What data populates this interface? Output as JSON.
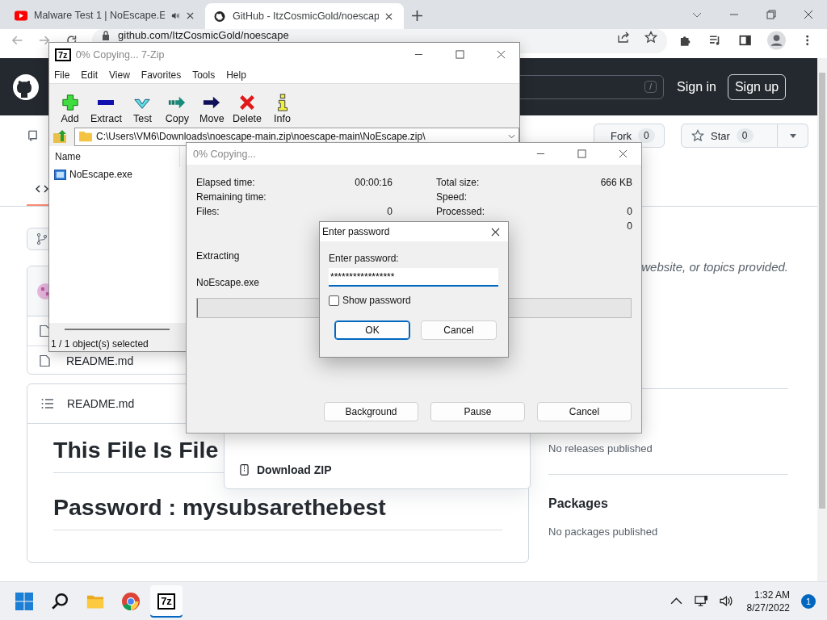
{
  "browser": {
    "tabs": [
      {
        "kind": "youtube",
        "title": "Malware Test 1 | NoEscape.E",
        "audio": true,
        "selected": false
      },
      {
        "kind": "github",
        "title": "GitHub - ItzCosmicGold/noescap",
        "audio": false,
        "selected": true
      }
    ],
    "url": "github.com/ItzCosmicGold/noescape"
  },
  "github": {
    "search_key": "/",
    "sign_in": "Sign in",
    "sign_up": "Sign up",
    "fork": {
      "label": "Fork",
      "count": "0"
    },
    "star": {
      "label": "Star",
      "count": "0"
    },
    "files": [
      "README.md"
    ],
    "readme": {
      "title": "README.md",
      "headings": [
        "This File Is File",
        "Password : mysubsarethebest"
      ]
    },
    "about": "website, or topics provided.",
    "releases_empty": "No releases published",
    "packages_title": "Packages",
    "packages_empty": "No packages published",
    "download_menu": [
      "Download ZIP"
    ]
  },
  "sevenzip": {
    "icon_text": "7z",
    "title": "0% Copying... 7-Zip",
    "menu": [
      "File",
      "Edit",
      "View",
      "Favorites",
      "Tools",
      "Help"
    ],
    "toolbar": [
      {
        "kind": "add",
        "label": "Add"
      },
      {
        "kind": "extract",
        "label": "Extract"
      },
      {
        "kind": "test",
        "label": "Test"
      },
      {
        "kind": "copy",
        "label": "Copy"
      },
      {
        "kind": "move",
        "label": "Move"
      },
      {
        "kind": "delete",
        "label": "Delete"
      },
      {
        "kind": "info",
        "label": "Info"
      }
    ],
    "path": "C:\\Users\\VM6\\Downloads\\noescape-main.zip\\noescape-main\\NoEscape.zip\\",
    "column": "Name",
    "items": [
      {
        "name": "NoEscape.exe",
        "selected": false
      }
    ],
    "status": "1 / 1 object(s) selected"
  },
  "progress": {
    "title": "0% Copying...",
    "left": [
      {
        "label": "Elapsed time:",
        "value": "00:00:16"
      },
      {
        "label": "Remaining time:"
      },
      {
        "label": "Files:",
        "value": "0"
      }
    ],
    "right": [
      {
        "label": "Total size:",
        "value": "666 KB"
      },
      {
        "label": "Speed:"
      },
      {
        "label": "Processed:",
        "value": "0"
      },
      {
        "value": "0"
      }
    ],
    "action": "Extracting",
    "file": "NoEscape.exe",
    "level": 0,
    "buttons": [
      "Background",
      "Pause",
      "Cancel"
    ]
  },
  "password": {
    "title": "Enter password",
    "label": "Enter password:",
    "value": "*****************",
    "show_label": "Show password",
    "checked": false,
    "buttons": [
      {
        "label": "OK",
        "default": true
      },
      {
        "label": "Cancel",
        "default": false
      }
    ]
  },
  "taskbar": {
    "apps": [
      {
        "kind": "start",
        "active": false
      },
      {
        "kind": "search",
        "active": false
      },
      {
        "kind": "folder",
        "active": false
      },
      {
        "kind": "chrome",
        "active": false
      },
      {
        "kind": "sevenzip",
        "label": "7z",
        "active": true
      }
    ],
    "time": "1:32 AM",
    "date": "8/27/2022",
    "badge": "1"
  }
}
